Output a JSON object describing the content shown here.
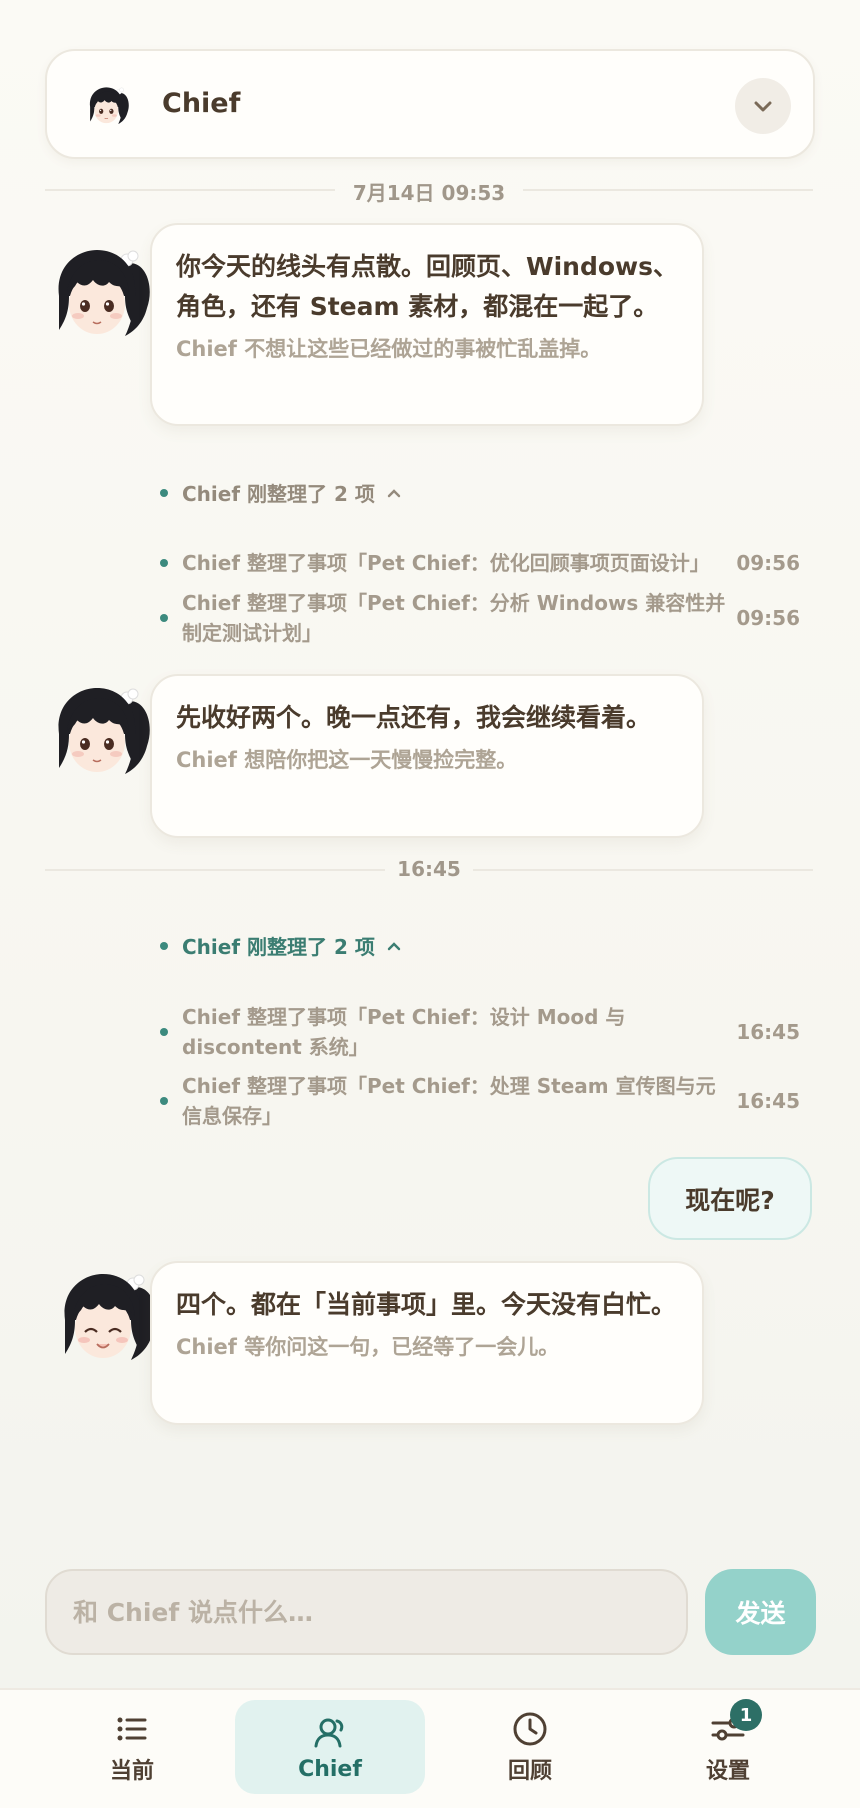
{
  "header": {
    "name": "Chief"
  },
  "dividers": {
    "first": "7月14日 09:53",
    "second": "16:45"
  },
  "messages": {
    "m1_main": "你今天的线头有点散。回顾页、Windows、角色，还有 Steam 素材，都混在一起了。",
    "m1_sub": "Chief 不想让这些已经做过的事被忙乱盖掉。",
    "m2_main": "先收好两个。晚一点还有，我会继续看着。",
    "m2_sub": "Chief 想陪你把这一天慢慢捡完整。",
    "user": "现在呢?",
    "m3_main": "四个。都在「当前事项」里。今天没有白忙。",
    "m3_sub": "Chief 等你问这一句，已经等了一会儿。"
  },
  "activity": {
    "group1": {
      "summary": "Chief 刚整理了 2 项",
      "items": [
        {
          "text": "Chief 整理了事项「Pet Chief：优化回顾事项页面设计」",
          "time": "09:56"
        },
        {
          "text": "Chief 整理了事项「Pet Chief：分析 Windows 兼容性并制定测试计划」",
          "time": "09:56"
        }
      ]
    },
    "group2": {
      "summary": "Chief 刚整理了 2 项",
      "items": [
        {
          "text": "Chief 整理了事项「Pet Chief：设计 Mood 与 discontent 系统」",
          "time": "16:45"
        },
        {
          "text": "Chief 整理了事项「Pet Chief：处理 Steam 宣传图与元信息保存」",
          "time": "16:45"
        }
      ]
    }
  },
  "composer": {
    "placeholder": "和 Chief 说点什么…",
    "send_label": "发送"
  },
  "tabs": {
    "current": "当前",
    "chief": "Chief",
    "review": "回顾",
    "settings": "设置",
    "settings_badge": "1"
  },
  "colors": {
    "accent": "#2d6f66",
    "send": "#94d2ca",
    "active_tab": "#e1f2ef"
  }
}
